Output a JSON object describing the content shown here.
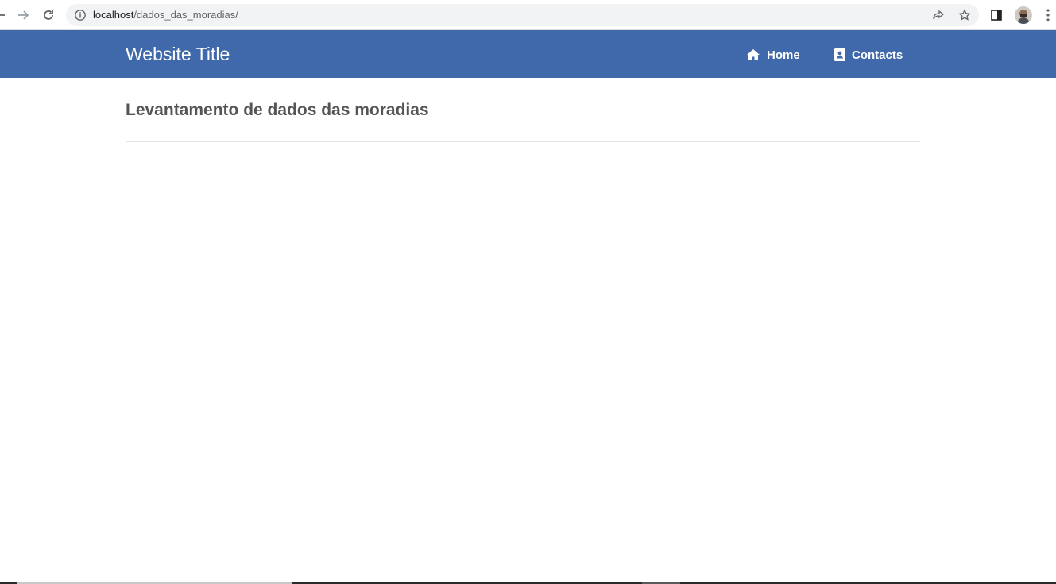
{
  "browser": {
    "url_host": "localhost",
    "url_path": "/dados_das_moradias/",
    "icons": [
      "back-arrow-icon",
      "forward-arrow-icon",
      "reload-icon",
      "info-icon",
      "share-icon",
      "star-icon",
      "side-panel-icon",
      "avatar",
      "more-menu-icon"
    ]
  },
  "site": {
    "title": "Website Title",
    "nav": [
      {
        "label": "Home",
        "icon": "home-icon"
      },
      {
        "label": "Contacts",
        "icon": "contact-card-icon"
      }
    ]
  },
  "page": {
    "heading": "Levantamento de dados das moradias"
  },
  "colors": {
    "navbar": "#3f69aa",
    "heading": "#555555",
    "nav_text": "#ffffff"
  }
}
